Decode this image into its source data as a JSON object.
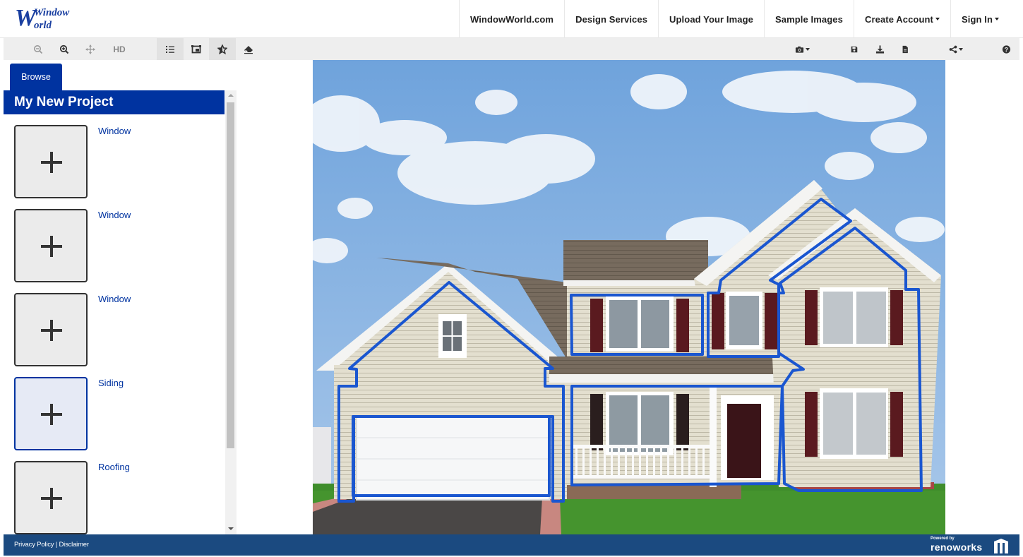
{
  "brand": {
    "logo_line1": "Window",
    "logo_line2": "World",
    "accent": "#0033a0",
    "footer_bg": "#1b4a80",
    "outline_color": "#1a56d0"
  },
  "nav": {
    "items": [
      {
        "label": "WindowWorld.com",
        "dropdown": false
      },
      {
        "label": "Design Services",
        "dropdown": false
      },
      {
        "label": "Upload Your Image",
        "dropdown": false
      },
      {
        "label": "Sample Images",
        "dropdown": false
      },
      {
        "label": "Create Account",
        "dropdown": true
      },
      {
        "label": "Sign In",
        "dropdown": true
      }
    ]
  },
  "toolbar": {
    "left": [
      {
        "icon": "zoom-out-icon"
      },
      {
        "icon": "zoom-in-icon"
      },
      {
        "icon": "pan-icon"
      },
      {
        "icon": "hd-toggle",
        "label": "HD"
      },
      {
        "icon": "list-icon",
        "active": true
      },
      {
        "icon": "compare-icon"
      },
      {
        "icon": "favorites-icon",
        "active": true
      },
      {
        "icon": "eraser-icon"
      }
    ],
    "right": [
      {
        "icon": "camera-icon",
        "dropdown": true
      },
      {
        "icon": "save-icon"
      },
      {
        "icon": "download-icon"
      },
      {
        "icon": "document-icon"
      },
      {
        "icon": "share-icon",
        "dropdown": true
      },
      {
        "icon": "help-icon"
      }
    ]
  },
  "sidebar": {
    "tab_label": "Browse",
    "project_title": "My New Project",
    "categories": [
      {
        "label": "Window",
        "selected": false
      },
      {
        "label": "Window",
        "selected": false
      },
      {
        "label": "Window",
        "selected": false
      },
      {
        "label": "Siding",
        "selected": true
      },
      {
        "label": "Roofing",
        "selected": false
      }
    ]
  },
  "canvas": {
    "image_description": "Two-story house with beige siding, garage and front porch; selectable regions outlined in blue"
  },
  "footer": {
    "privacy": "Privacy Policy",
    "separator": "|",
    "disclaimer": "Disclaimer",
    "powered_by": "Powered by",
    "powered_brand": "renoworks"
  }
}
